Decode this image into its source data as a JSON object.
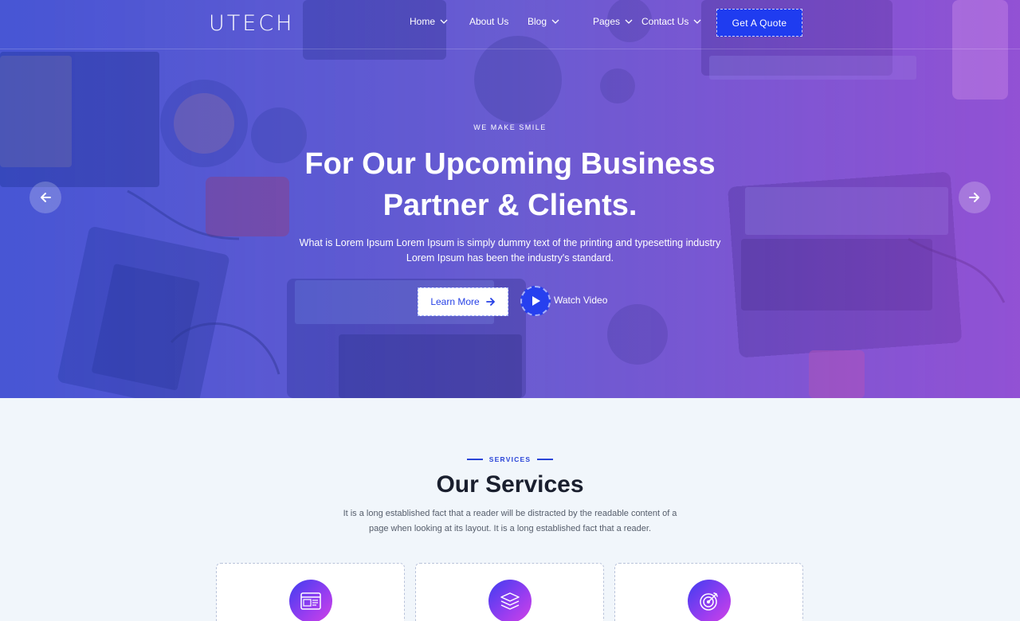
{
  "brand": {
    "logo": "UTECH"
  },
  "nav": {
    "items": [
      {
        "label": "Home",
        "has_dropdown": true
      },
      {
        "label": "About Us",
        "has_dropdown": false
      },
      {
        "label": "Blog",
        "has_dropdown": true
      },
      {
        "label": "Pages",
        "has_dropdown": true
      },
      {
        "label": "Contact Us",
        "has_dropdown": true
      }
    ],
    "cta_label": "Get A Quote"
  },
  "hero": {
    "eyebrow": "WE MAKE SMILE",
    "headline_line1": "For Our Upcoming Business",
    "headline_line2": "Partner & Clients.",
    "subtext_line1": "What is Lorem Ipsum Lorem Ipsum is simply dummy text of the printing and typesetting industry",
    "subtext_line2": "Lorem Ipsum has been the industry's standard.",
    "learn_more_label": "Learn More",
    "watch_video_label": "Watch Video"
  },
  "services": {
    "eyebrow": "SERVICES",
    "title": "Our Services",
    "desc_line1": "It is a long established fact that a reader will be distracted by the readable content of a",
    "desc_line2": "page when looking at its layout. It is a long established fact that a reader.",
    "cards": [
      {
        "icon": "browser-window-icon"
      },
      {
        "icon": "layers-icon"
      },
      {
        "icon": "target-icon"
      }
    ]
  },
  "colors": {
    "accent": "#1f3cf0",
    "gradient_start": "#2f57d8",
    "gradient_end": "#b24ae0",
    "text_dark": "#1a1f2e"
  }
}
